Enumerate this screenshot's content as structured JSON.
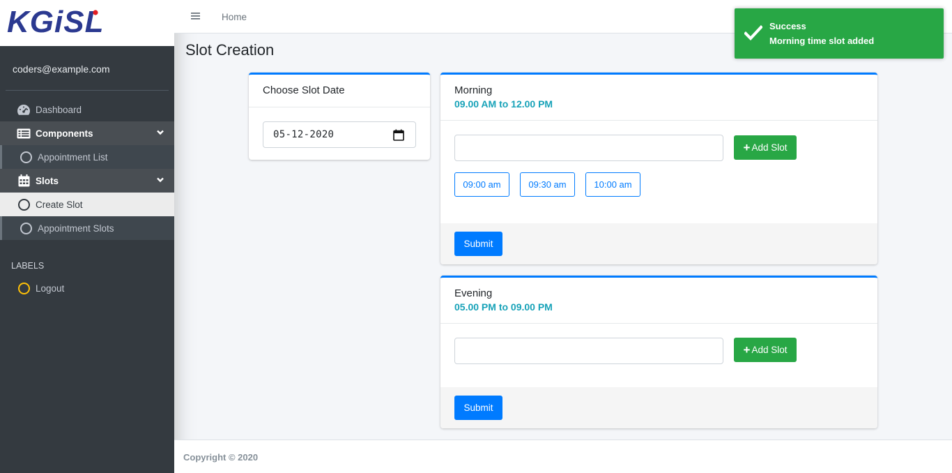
{
  "brand": {
    "logo_text": "KGiSL"
  },
  "sidebar": {
    "user": "coders@example.com",
    "items": [
      {
        "label": "Dashboard"
      },
      {
        "label": "Components"
      },
      {
        "label": "Appointment List"
      },
      {
        "label": "Slots"
      },
      {
        "label": "Create Slot"
      },
      {
        "label": "Appointment Slots"
      }
    ],
    "section_header": "LABELS",
    "logout": "Logout"
  },
  "header": {
    "home": "Home"
  },
  "page": {
    "title": "Slot Creation"
  },
  "date_card": {
    "title": "Choose Slot Date",
    "date_value": "05-12-2020"
  },
  "morning_card": {
    "title": "Morning",
    "subtitle": "09.00 AM to 12.00 PM",
    "input_value": "",
    "add_label": "Add Slot",
    "slots": [
      "09:00 am",
      "09:30 am",
      "10:00 am"
    ],
    "submit_label": "Submit"
  },
  "evening_card": {
    "title": "Evening",
    "subtitle": "05.00 PM to 09.00 PM",
    "input_value": "",
    "add_label": "Add Slot",
    "submit_label": "Submit"
  },
  "footer": {
    "copyright": "Copyright © 2020"
  },
  "toast": {
    "title": "Success",
    "message": "Morning time slot added"
  },
  "colors": {
    "sidebar_bg": "#343a40",
    "primary": "#007bff",
    "success": "#28a745",
    "info": "#17a2b8",
    "logo_blue": "#2b3990"
  }
}
